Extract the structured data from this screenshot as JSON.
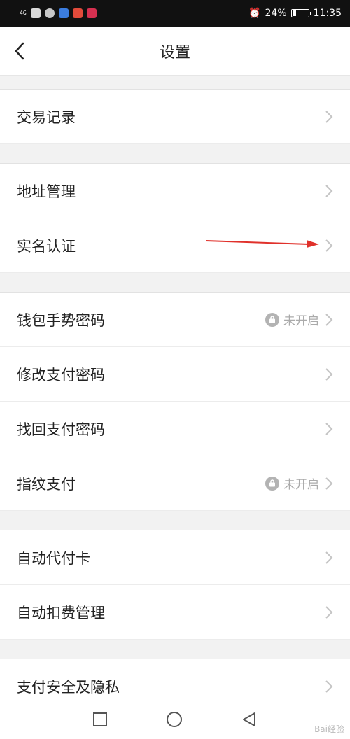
{
  "status_bar": {
    "network": "4G",
    "battery_percent": "24%",
    "battery_level": 0.24,
    "time": "11:35"
  },
  "header": {
    "title": "设置"
  },
  "sections": [
    {
      "rows": [
        {
          "label": "交易记录",
          "status": ""
        }
      ]
    },
    {
      "rows": [
        {
          "label": "地址管理",
          "status": ""
        },
        {
          "label": "实名认证",
          "status": ""
        }
      ]
    },
    {
      "rows": [
        {
          "label": "钱包手势密码",
          "status": "未开启"
        },
        {
          "label": "修改支付密码",
          "status": ""
        },
        {
          "label": "找回支付密码",
          "status": ""
        },
        {
          "label": "指纹支付",
          "status": "未开启"
        }
      ]
    },
    {
      "rows": [
        {
          "label": "自动代付卡",
          "status": ""
        },
        {
          "label": "自动扣费管理",
          "status": ""
        }
      ]
    },
    {
      "rows": [
        {
          "label": "支付安全及隐私",
          "status": ""
        }
      ]
    }
  ],
  "watermark": "Bai经验",
  "colors": {
    "annotation_arrow": "#e0312b",
    "chevron": "#c4c4c4"
  }
}
